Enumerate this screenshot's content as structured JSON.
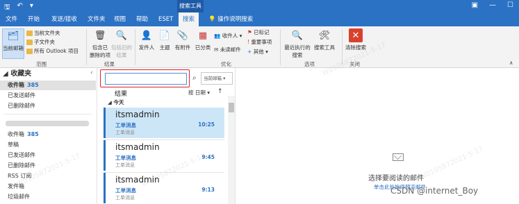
{
  "titlebar": {
    "context_title": "搜索工具"
  },
  "tabs": [
    "文件",
    "开始",
    "发送/接收",
    "文件夹",
    "视图",
    "帮助",
    "ESET",
    "搜索"
  ],
  "tell_me": "操作说明搜索",
  "ribbon": {
    "current_mailbox": "当前邮箱",
    "current_folder": "当前文件夹",
    "subfolders": "子文件夹",
    "all_outlook_items": "所有 Outlook 项目",
    "scope_group": "范围",
    "include_deleted": "包含已\n删除的项",
    "include_older": "包括旧的结果",
    "results_group": "结果",
    "from": "发件人",
    "subject": "主题",
    "has_attachment": "有附件",
    "categorized": "已分类",
    "sent_to": "收件人",
    "unread": "未读邮件",
    "flagged": "已标记",
    "important": "重要事项",
    "more": "其他",
    "refine_group": "优化",
    "recent_searches": "最近执行的\n搜索",
    "search_tools": "搜索工具",
    "options_group": "选项",
    "close_search": "清除搜索",
    "close_group": "关闭"
  },
  "folders": {
    "favorites_header": "收藏夹",
    "favorites": [
      {
        "label": "收件箱",
        "count": "385",
        "selected": true
      },
      {
        "label": "已发送邮件",
        "count": ""
      },
      {
        "label": "已删除邮件",
        "count": ""
      }
    ],
    "mailbox": [
      {
        "label": "收件箱",
        "count": "385"
      },
      {
        "label": "草稿",
        "count": ""
      },
      {
        "label": "已发送邮件",
        "count": ""
      },
      {
        "label": "已删除邮件",
        "count": ""
      },
      {
        "label": "RSS 订阅",
        "count": ""
      },
      {
        "label": "发件箱",
        "count": ""
      },
      {
        "label": "垃圾邮件",
        "count": ""
      }
    ]
  },
  "search": {
    "placeholder": "",
    "scope": "当前邮箱"
  },
  "list": {
    "title": "结果",
    "sort": "按 日期",
    "group": "今天",
    "messages": [
      {
        "sender": "itsmadmin",
        "subject": "工单消息",
        "preview": "工单消息",
        "time": "10:25",
        "selected": true
      },
      {
        "sender": "itsmadmin",
        "subject": "工单消息",
        "preview": "工单消息",
        "time": "9:45"
      },
      {
        "sender": "itsmadmin",
        "subject": "工单消息",
        "preview": "工单消息",
        "time": "9:13"
      }
    ]
  },
  "reading": {
    "empty_text": "选择要阅读的邮件",
    "empty_link": "单击此处始终预览邮件"
  },
  "watermark": "W0105872021-5-17",
  "overlay": "CSDN @internet_Boy",
  "colors": {
    "accent": "#2b71c4",
    "highlight": "#e02020"
  }
}
